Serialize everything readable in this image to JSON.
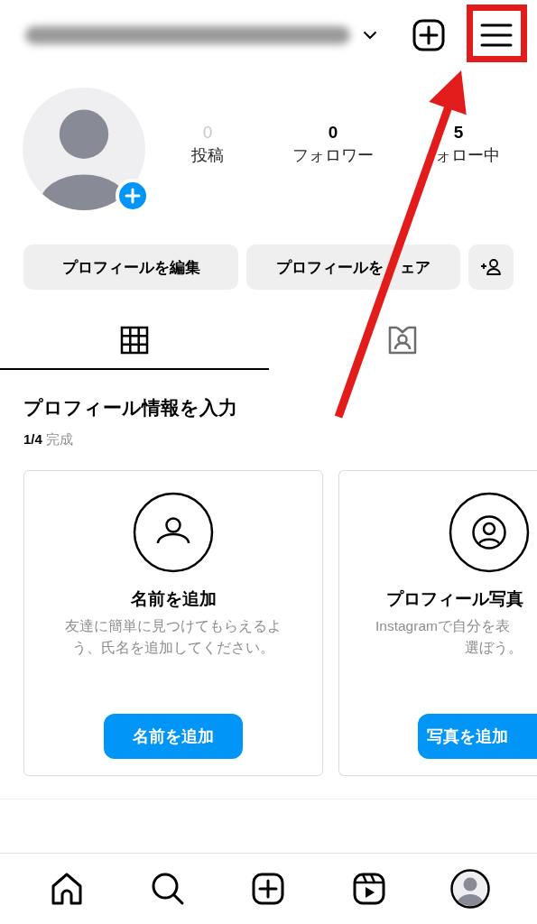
{
  "header": {
    "username_blurred": true
  },
  "profile": {
    "stats": [
      {
        "count": "0",
        "label": "投稿",
        "muted": true
      },
      {
        "count": "0",
        "label": "フォロワー",
        "muted": false
      },
      {
        "count": "5",
        "label": "ォロー中",
        "muted": false
      }
    ]
  },
  "actions": [
    {
      "label": "プロフィールを編集"
    },
    {
      "label": "プロフィールを",
      "label_after_arrow": "ェア"
    }
  ],
  "tabs": [
    {
      "kind": "grid",
      "selected": true
    },
    {
      "kind": "tagged",
      "selected": false
    }
  ],
  "completion": {
    "title": "プロフィール情報を入力",
    "count": "1/4",
    "label": "完成",
    "cards": [
      {
        "kind": "name",
        "title": "名前を追加",
        "description": [
          "友達に簡単に見つけてもらえるよ",
          "う、氏名を追加してください。"
        ],
        "button": "名前を追加"
      },
      {
        "kind": "photo",
        "title": "プロフィール写真",
        "description": [
          "Instagramで自分を表",
          "選ぼう。"
        ],
        "button": "写真を追加"
      }
    ]
  },
  "nav": [
    {
      "kind": "home",
      "selected": false
    },
    {
      "kind": "search",
      "selected": false
    },
    {
      "kind": "create",
      "selected": false
    },
    {
      "kind": "reels",
      "selected": false
    },
    {
      "kind": "profile",
      "selected": true
    }
  ],
  "annotations": {
    "highlight_box": true,
    "arrow": true
  }
}
